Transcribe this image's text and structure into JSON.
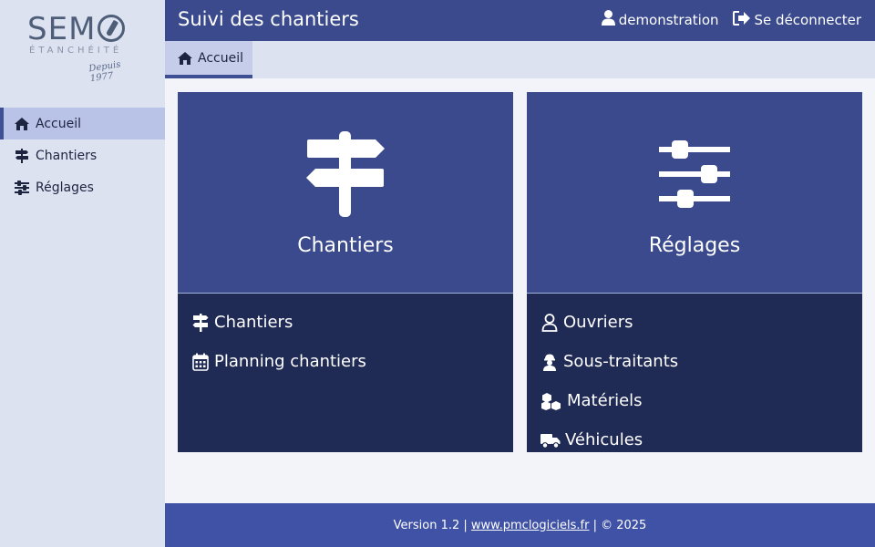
{
  "logo": {
    "main": "SEM",
    "sub": "ÉTANCHÉITÉ",
    "since": "Depuis 1977"
  },
  "sidebar": {
    "items": [
      {
        "label": "Accueil",
        "icon": "home-icon",
        "active": true
      },
      {
        "label": "Chantiers",
        "icon": "signpost-icon",
        "active": false
      },
      {
        "label": "Réglages",
        "icon": "sliders-icon",
        "active": false
      }
    ]
  },
  "header": {
    "title": "Suivi des chantiers",
    "user": "demonstration",
    "logout": "Se déconnecter"
  },
  "tabs": [
    {
      "label": "Accueil",
      "icon": "home-icon"
    }
  ],
  "cards": [
    {
      "title": "Chantiers",
      "icon": "signpost-icon",
      "links": [
        {
          "label": "Chantiers",
          "icon": "signpost-icon"
        },
        {
          "label": "Planning chantiers",
          "icon": "calendar-icon"
        }
      ]
    },
    {
      "title": "Réglages",
      "icon": "sliders-icon",
      "links": [
        {
          "label": "Ouvriers",
          "icon": "user-icon"
        },
        {
          "label": "Sous-traitants",
          "icon": "worker-icon"
        },
        {
          "label": "Matériels",
          "icon": "boxes-icon"
        },
        {
          "label": "Véhicules",
          "icon": "truck-icon"
        }
      ]
    }
  ],
  "footer": {
    "version": "Version 1.2 |",
    "link": "www.pmclogiciels.fr",
    "copyright": "| © 2025"
  },
  "colors": {
    "header": "#3a4a8c",
    "sidebar": "#dde2f1",
    "card_top": "#3a4a8c",
    "card_bottom": "#1f2a55",
    "footer": "#3f52a6",
    "active_nav": "#b9c3e7"
  }
}
